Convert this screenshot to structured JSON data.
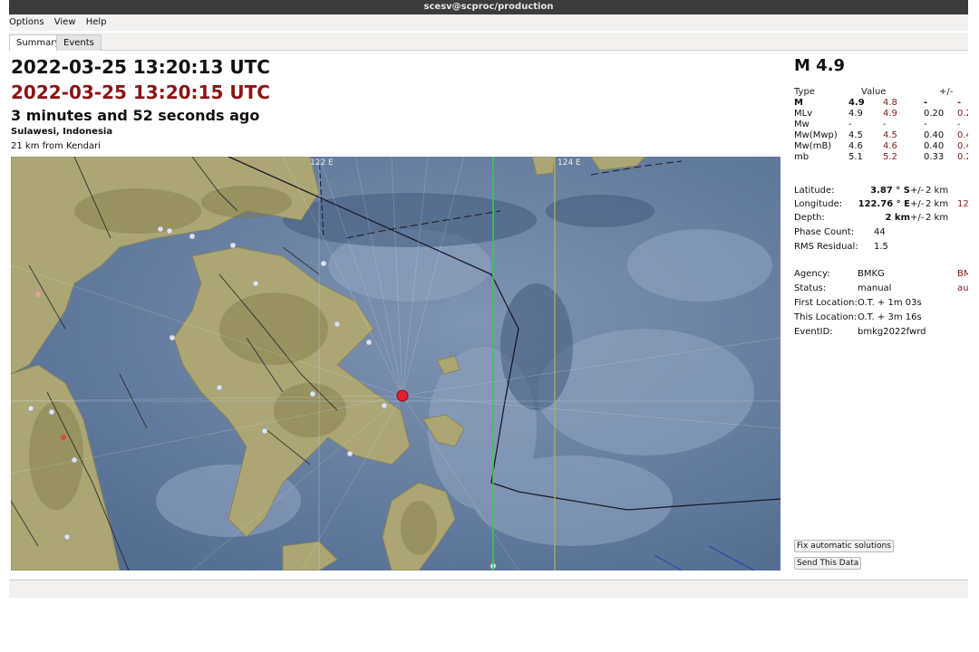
{
  "window": {
    "title": "scesv@scproc/production"
  },
  "menu": {
    "items": [
      "Options",
      "View",
      "Help"
    ]
  },
  "tabs": [
    {
      "label": "Summary",
      "active": true
    },
    {
      "label": "Events",
      "active": false
    }
  ],
  "event": {
    "origin_time": "2022-03-25 13:20:13 UTC",
    "current_time": "2022-03-25 13:20:15 UTC",
    "elapsed": "3 minutes and 52 seconds ago",
    "region": "Sulawesi, Indonesia",
    "nearest": "21 km from Kendari"
  },
  "map": {
    "grid_labels": [
      "122 E",
      "124 E"
    ],
    "colors": {
      "sea": "#5a7294",
      "land": "#a9a374",
      "epicenter": "#e01f2f"
    }
  },
  "magnitude": {
    "title": "M 4.9",
    "header": {
      "type": "Type",
      "value": "Value",
      "uncertainty": "+/-"
    },
    "rows": [
      {
        "type": "M",
        "v1": "4.9",
        "v2": "4.8",
        "u1": "-",
        "u2": "-"
      },
      {
        "type": "MLv",
        "v1": "4.9",
        "v2": "4.9",
        "u1": "0.20",
        "u2": "0.2"
      },
      {
        "type": "Mw",
        "v1": "-",
        "v2": "-",
        "u1": "-",
        "u2": "-"
      },
      {
        "type": "Mw(Mwp)",
        "v1": "4.5",
        "v2": "4.5",
        "u1": "0.40",
        "u2": "0.4"
      },
      {
        "type": "Mw(mB)",
        "v1": "4.6",
        "v2": "4.6",
        "u1": "0.40",
        "u2": "0.4"
      },
      {
        "type": "mb",
        "v1": "5.1",
        "v2": "5.2",
        "u1": "0.33",
        "u2": "0.2"
      }
    ]
  },
  "location": {
    "latitude_label": "Latitude:",
    "latitude": "3.87 ° S",
    "latitude_pm": "+/-",
    "latitude_unc": "2 km",
    "longitude_label": "Longitude:",
    "longitude": "122.76 ° E",
    "longitude_pm": "+/-",
    "longitude_unc": "2 km",
    "longitude_extra": "12",
    "depth_label": "Depth:",
    "depth": "2 km",
    "depth_pm": "+/-",
    "depth_unc": "2 km",
    "phase_label": "Phase Count:",
    "phase": "44",
    "rms_label": "RMS Residual:",
    "rms": "1.5"
  },
  "origin": {
    "agency_label": "Agency:",
    "agency": "BMKG",
    "agency_extra": "BM",
    "status_label": "Status:",
    "status": "manual",
    "status_extra": "au",
    "first_label": "First Location:",
    "first": "O.T. + 1m 03s",
    "this_label": "This Location:",
    "this": "O.T. + 3m 16s",
    "event_label": "EventID:",
    "event": "bmkg2022fwrd"
  },
  "buttons": {
    "fix": "Fix automatic solutions",
    "send": "Send This Data"
  }
}
